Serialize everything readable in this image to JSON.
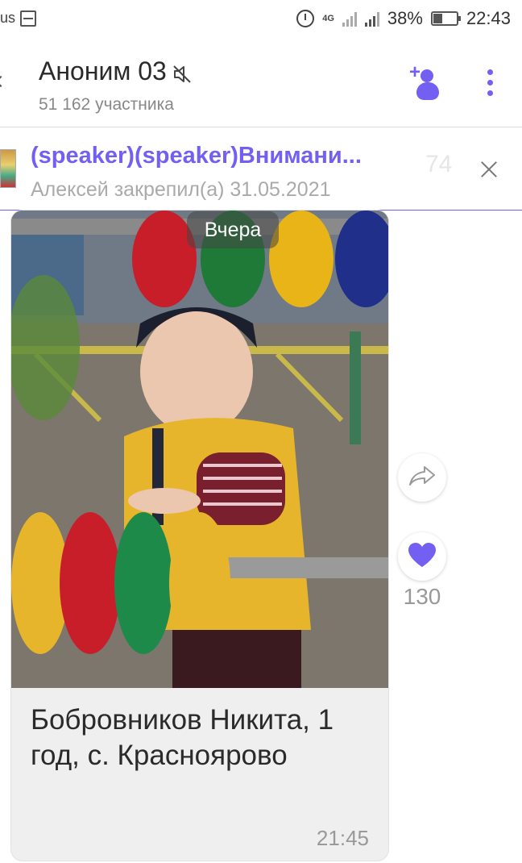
{
  "status_bar": {
    "left_text": "us",
    "battery": "38%",
    "time": "22:43",
    "network": "4G"
  },
  "header": {
    "title": "Аноним 03",
    "subtitle": "51 162 участника"
  },
  "pinned": {
    "title": "(speaker)(speaker)Внимани...",
    "subtitle": "Алексей закрепил(а) 31.05.2021",
    "background_number": "74"
  },
  "message": {
    "date_chip": "Вчера",
    "caption": "Бобровников Никита, 1 год, с. Краснoярово",
    "time": "21:45",
    "like_count": "130"
  },
  "colors": {
    "accent": "#7360f2"
  }
}
